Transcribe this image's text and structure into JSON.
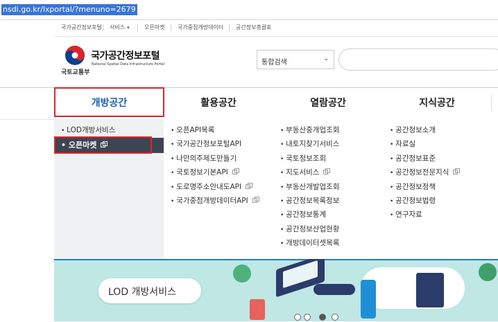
{
  "browser": {
    "url": "nsdi.go.kr/lxportal/?menuno=2679"
  },
  "utility_bar": {
    "items": [
      "국가공간정보포털",
      "서비스",
      "오픈마켓",
      "국가중점개방데이터",
      "공간정보총괄표"
    ]
  },
  "brand": {
    "ministry": "국토교통부",
    "title": "국가공간정보포털",
    "subtitle": "National Spatial Data Infrastructure Portal"
  },
  "search": {
    "select_label": "통합검색",
    "select_icon": "chevron-down-icon"
  },
  "nav": {
    "tabs": [
      "개방공간",
      "활용공간",
      "열람공간",
      "지식공간"
    ],
    "active": "개방공간"
  },
  "menus": {
    "col1": [
      {
        "label": "LOD개방서비스"
      },
      {
        "label": "오픈마켓",
        "copy": true,
        "highlighted": true
      }
    ],
    "col2": [
      {
        "label": "오픈API목록"
      },
      {
        "label": "국가공간정보포털API"
      },
      {
        "label": "나만의주제도만들기"
      },
      {
        "label": "국토정보기본API",
        "copy": true
      },
      {
        "label": "도로명주소안내도API",
        "copy": true
      },
      {
        "label": "국가중점개방데이터API",
        "copy": true
      }
    ],
    "col3": [
      {
        "label": "부동산중개업조회"
      },
      {
        "label": "내토지찾기서비스"
      },
      {
        "label": "국토정보조회"
      },
      {
        "label": "지도서비스",
        "copy": true
      },
      {
        "label": "부동산개발업조회"
      },
      {
        "label": "공간정보목록정보"
      },
      {
        "label": "공간정보통계"
      },
      {
        "label": "공간정보산업현황"
      },
      {
        "label": "개방데이터셋목록"
      }
    ],
    "col4": [
      {
        "label": "공간정보소개"
      },
      {
        "label": "자료실"
      },
      {
        "label": "공간정보표준"
      },
      {
        "label": "공간정보전문지식",
        "copy": true
      },
      {
        "label": "공간정보정책"
      },
      {
        "label": "공간정보법령"
      },
      {
        "label": "연구자료"
      }
    ]
  },
  "hero": {
    "banner_label": "LOD 개방서비스",
    "slides": 4,
    "active_slide": 3
  },
  "colors": {
    "accent": "#1a5fb4",
    "highlight_box": "#d9262c",
    "selected_bg": "#3f4452",
    "hero_bg": "#bfe7e4"
  }
}
